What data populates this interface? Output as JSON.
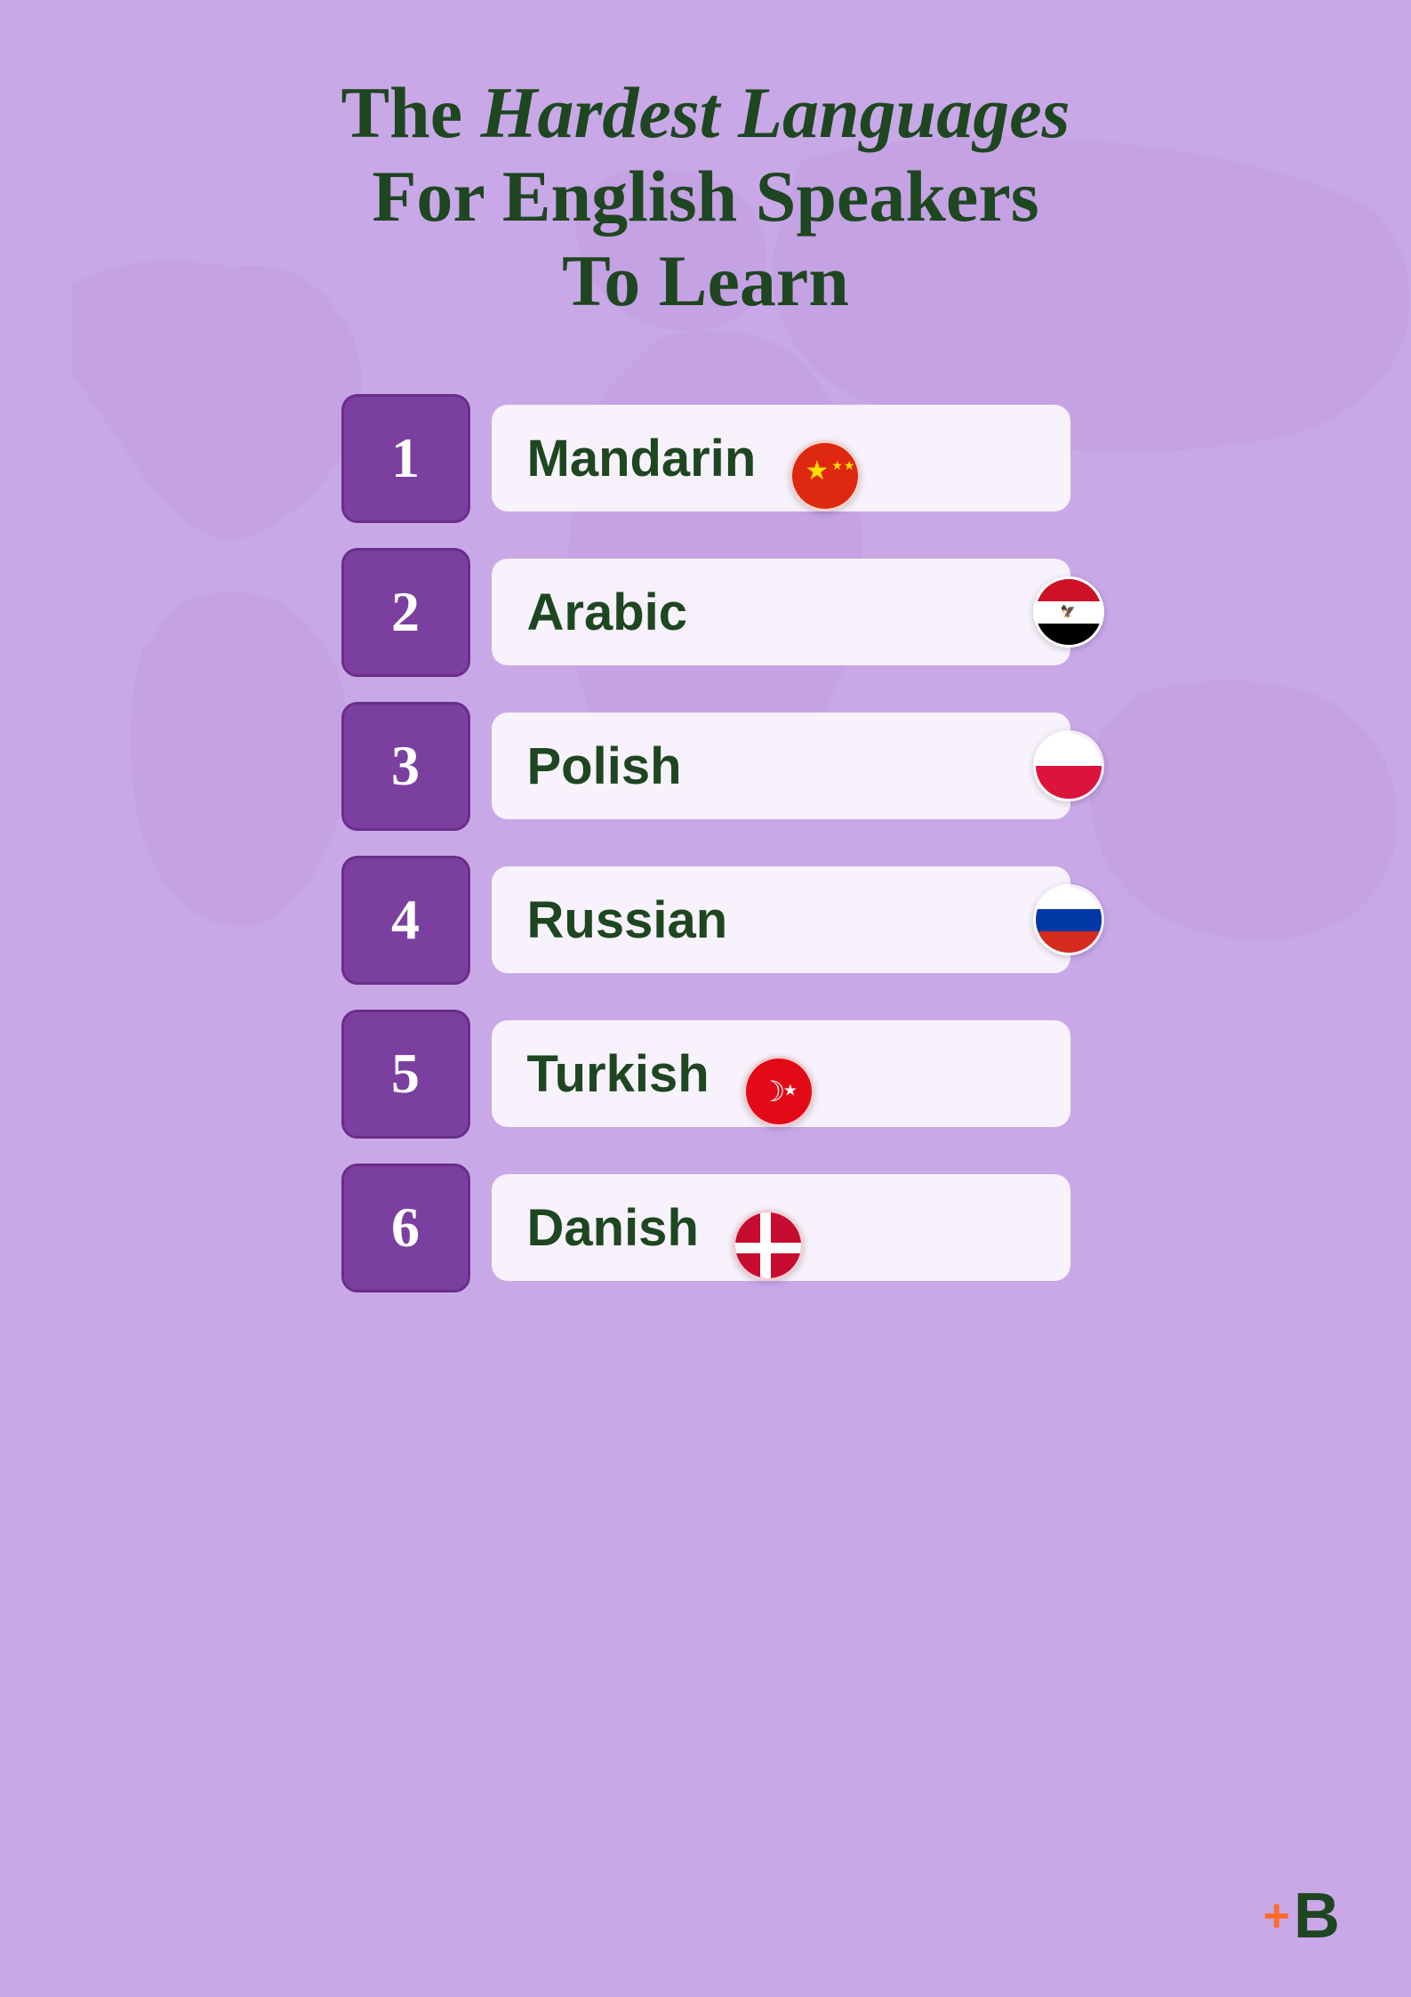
{
  "page": {
    "background_color": "#c9a8e8",
    "title_line1": "The ",
    "title_italic": "Hardest Languages",
    "title_line2": "For English Speakers",
    "title_line3": "To Learn"
  },
  "languages": [
    {
      "rank": "1",
      "name": "Mandarin",
      "flag": "china"
    },
    {
      "rank": "2",
      "name": "Arabic",
      "flag": "egypt"
    },
    {
      "rank": "3",
      "name": "Polish",
      "flag": "poland"
    },
    {
      "rank": "4",
      "name": "Russian",
      "flag": "russia"
    },
    {
      "rank": "5",
      "name": "Turkish",
      "flag": "turkey"
    },
    {
      "rank": "6",
      "name": "Danish",
      "flag": "denmark"
    }
  ],
  "branding": {
    "plus": "+",
    "letter": "B"
  }
}
